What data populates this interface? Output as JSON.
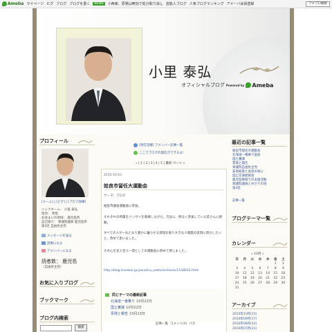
{
  "topbar": {
    "logo": "Ameba",
    "links": [
      "マイページ",
      "ピグ",
      "ブログ",
      "ブログを書く"
    ],
    "news_badge": "NEWS",
    "news_text": "小西孝、原発は無効で処分取り消し",
    "extra_links": [
      "芸能人ブログ",
      "人気ブログランキング",
      "アメーバ会員登録"
    ],
    "search_label": "アメブロ検索"
  },
  "header": {
    "title": "小里 泰弘",
    "subtitle": "オフィシャルブログ",
    "powered_by": "Powered by",
    "brand": "Ameba"
  },
  "left_sidebar": {
    "profile_heading": "プロフィール",
    "profile_links": "[ルーム] | [ピグ] | [プロフ詳細]",
    "profile_lines": [
      "ニックネーム： 小里 泰弘",
      "性別： 男性",
      "お住まいの地域： 鹿児島県",
      "自己紹介： 衆議院議員 鹿児島県",
      "第4区 自由民主党"
    ],
    "actions": [
      "メッセージを送る",
      "読者になる",
      "アメンバーになる"
    ],
    "name_big": "読者数： 鹿児島",
    "name_sub": "（自由民主党）",
    "favorites_heading": "お気に入りブログ",
    "bookmark_heading": "ブックマーク",
    "search_heading": "ブログ内検索",
    "search_button": "検索"
  },
  "main": {
    "notices": [
      "[現在活躍] アメンバー記事一覧",
      "ここでブログの発信ができるよ!"
    ],
    "pager": "« | 1 | 2 | 3 | 4 | 5 | 最初 ページ »",
    "post": {
      "date": "2010-10-23",
      "title": "姶良市留任大運動会",
      "theme": "テーマ：ブログ",
      "paragraphs": [
        "姶良市議会運動会に参加。",
        "それぞれの所属をバンザイを発揮しながら、元気に、明るく参加している皆さんに感動。",
        "すべての人が一丸となり豊かに暮らせる環境を創り大きな人間愛の実現に努力したいと、改めて思いました。",
        "その心を支え合う一環としての運動会に改めて感じました。"
      ],
      "url": "http://blog.livedoor.jp/yasuhiro_ozato/archives/1158032.html",
      "theme_box_title": "同じテーマの最新記事",
      "theme_items": [
        {
          "label": "北海道一番乗り",
          "date": "10月22日"
        },
        {
          "label": "国土審議",
          "date": "10月22日"
        },
        {
          "label": "票発と報告",
          "date": "10月13日"
        }
      ],
      "footer": [
        "記事一覧",
        "コメント(0)",
        "ペタ"
      ]
    }
  },
  "right_sidebar": {
    "recent_heading": "最近の記事一覧",
    "recent_items": [
      "姶良市留任大運動会",
      "北海道一番乗り国会",
      "国土審議",
      "票発と報告",
      "衆議院自由民主党",
      "安倍総裁と会談の後に",
      "国土交通委員会",
      "鹿児島東部での支援活動",
      "衆議院議員とゆかりの地",
      "第4区",
      "記事一覧"
    ],
    "theme_heading": "ブログテーマ一覧",
    "calendar_heading": "カレンダー",
    "calendar_caption": "« 10月 »",
    "calendar_days": [
      "日",
      "月",
      "火",
      "水",
      "木",
      "金",
      "土"
    ],
    "calendar_rows": [
      [
        "",
        "",
        "",
        "",
        "",
        "1",
        "2"
      ],
      [
        "3",
        "4",
        "5",
        "6",
        "7",
        "8",
        "9"
      ],
      [
        "10",
        "11",
        "12",
        "13",
        "14",
        "15",
        "16"
      ],
      [
        "17",
        "18",
        "19",
        "20",
        "21",
        "22",
        "23"
      ],
      [
        "24",
        "25",
        "26",
        "27",
        "28",
        "29",
        "30"
      ],
      [
        "31",
        "",
        "",
        "",
        "",
        "",
        ""
      ]
    ],
    "archive_heading": "アーカイブ",
    "archive_items": [
      "2010年10月(15)",
      "2010年09月(17)",
      "2010年08月(12)",
      "2010年07月(21)"
    ]
  },
  "colors": {
    "frame": "#958b76",
    "accent_green": "#3aa12b",
    "link_blue": "#3d5a99"
  }
}
